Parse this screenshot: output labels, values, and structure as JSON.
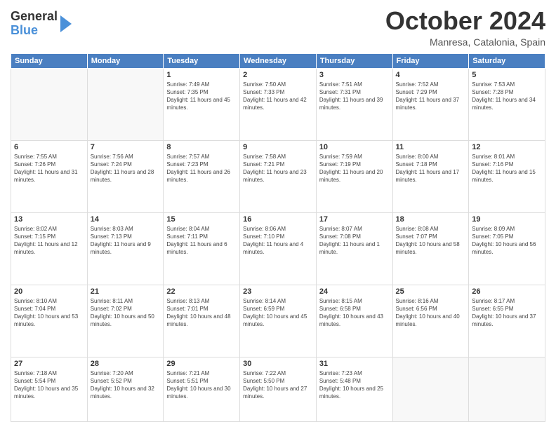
{
  "logo": {
    "general": "General",
    "blue": "Blue"
  },
  "header": {
    "title": "October 2024",
    "location": "Manresa, Catalonia, Spain"
  },
  "weekdays": [
    "Sunday",
    "Monday",
    "Tuesday",
    "Wednesday",
    "Thursday",
    "Friday",
    "Saturday"
  ],
  "days": [
    {
      "date": "",
      "sunrise": "",
      "sunset": "",
      "daylight": ""
    },
    {
      "date": "",
      "sunrise": "",
      "sunset": "",
      "daylight": ""
    },
    {
      "date": "1",
      "sunrise": "Sunrise: 7:49 AM",
      "sunset": "Sunset: 7:35 PM",
      "daylight": "Daylight: 11 hours and 45 minutes."
    },
    {
      "date": "2",
      "sunrise": "Sunrise: 7:50 AM",
      "sunset": "Sunset: 7:33 PM",
      "daylight": "Daylight: 11 hours and 42 minutes."
    },
    {
      "date": "3",
      "sunrise": "Sunrise: 7:51 AM",
      "sunset": "Sunset: 7:31 PM",
      "daylight": "Daylight: 11 hours and 39 minutes."
    },
    {
      "date": "4",
      "sunrise": "Sunrise: 7:52 AM",
      "sunset": "Sunset: 7:29 PM",
      "daylight": "Daylight: 11 hours and 37 minutes."
    },
    {
      "date": "5",
      "sunrise": "Sunrise: 7:53 AM",
      "sunset": "Sunset: 7:28 PM",
      "daylight": "Daylight: 11 hours and 34 minutes."
    },
    {
      "date": "6",
      "sunrise": "Sunrise: 7:55 AM",
      "sunset": "Sunset: 7:26 PM",
      "daylight": "Daylight: 11 hours and 31 minutes."
    },
    {
      "date": "7",
      "sunrise": "Sunrise: 7:56 AM",
      "sunset": "Sunset: 7:24 PM",
      "daylight": "Daylight: 11 hours and 28 minutes."
    },
    {
      "date": "8",
      "sunrise": "Sunrise: 7:57 AM",
      "sunset": "Sunset: 7:23 PM",
      "daylight": "Daylight: 11 hours and 26 minutes."
    },
    {
      "date": "9",
      "sunrise": "Sunrise: 7:58 AM",
      "sunset": "Sunset: 7:21 PM",
      "daylight": "Daylight: 11 hours and 23 minutes."
    },
    {
      "date": "10",
      "sunrise": "Sunrise: 7:59 AM",
      "sunset": "Sunset: 7:19 PM",
      "daylight": "Daylight: 11 hours and 20 minutes."
    },
    {
      "date": "11",
      "sunrise": "Sunrise: 8:00 AM",
      "sunset": "Sunset: 7:18 PM",
      "daylight": "Daylight: 11 hours and 17 minutes."
    },
    {
      "date": "12",
      "sunrise": "Sunrise: 8:01 AM",
      "sunset": "Sunset: 7:16 PM",
      "daylight": "Daylight: 11 hours and 15 minutes."
    },
    {
      "date": "13",
      "sunrise": "Sunrise: 8:02 AM",
      "sunset": "Sunset: 7:15 PM",
      "daylight": "Daylight: 11 hours and 12 minutes."
    },
    {
      "date": "14",
      "sunrise": "Sunrise: 8:03 AM",
      "sunset": "Sunset: 7:13 PM",
      "daylight": "Daylight: 11 hours and 9 minutes."
    },
    {
      "date": "15",
      "sunrise": "Sunrise: 8:04 AM",
      "sunset": "Sunset: 7:11 PM",
      "daylight": "Daylight: 11 hours and 6 minutes."
    },
    {
      "date": "16",
      "sunrise": "Sunrise: 8:06 AM",
      "sunset": "Sunset: 7:10 PM",
      "daylight": "Daylight: 11 hours and 4 minutes."
    },
    {
      "date": "17",
      "sunrise": "Sunrise: 8:07 AM",
      "sunset": "Sunset: 7:08 PM",
      "daylight": "Daylight: 11 hours and 1 minute."
    },
    {
      "date": "18",
      "sunrise": "Sunrise: 8:08 AM",
      "sunset": "Sunset: 7:07 PM",
      "daylight": "Daylight: 10 hours and 58 minutes."
    },
    {
      "date": "19",
      "sunrise": "Sunrise: 8:09 AM",
      "sunset": "Sunset: 7:05 PM",
      "daylight": "Daylight: 10 hours and 56 minutes."
    },
    {
      "date": "20",
      "sunrise": "Sunrise: 8:10 AM",
      "sunset": "Sunset: 7:04 PM",
      "daylight": "Daylight: 10 hours and 53 minutes."
    },
    {
      "date": "21",
      "sunrise": "Sunrise: 8:11 AM",
      "sunset": "Sunset: 7:02 PM",
      "daylight": "Daylight: 10 hours and 50 minutes."
    },
    {
      "date": "22",
      "sunrise": "Sunrise: 8:13 AM",
      "sunset": "Sunset: 7:01 PM",
      "daylight": "Daylight: 10 hours and 48 minutes."
    },
    {
      "date": "23",
      "sunrise": "Sunrise: 8:14 AM",
      "sunset": "Sunset: 6:59 PM",
      "daylight": "Daylight: 10 hours and 45 minutes."
    },
    {
      "date": "24",
      "sunrise": "Sunrise: 8:15 AM",
      "sunset": "Sunset: 6:58 PM",
      "daylight": "Daylight: 10 hours and 43 minutes."
    },
    {
      "date": "25",
      "sunrise": "Sunrise: 8:16 AM",
      "sunset": "Sunset: 6:56 PM",
      "daylight": "Daylight: 10 hours and 40 minutes."
    },
    {
      "date": "26",
      "sunrise": "Sunrise: 8:17 AM",
      "sunset": "Sunset: 6:55 PM",
      "daylight": "Daylight: 10 hours and 37 minutes."
    },
    {
      "date": "27",
      "sunrise": "Sunrise: 7:18 AM",
      "sunset": "Sunset: 5:54 PM",
      "daylight": "Daylight: 10 hours and 35 minutes."
    },
    {
      "date": "28",
      "sunrise": "Sunrise: 7:20 AM",
      "sunset": "Sunset: 5:52 PM",
      "daylight": "Daylight: 10 hours and 32 minutes."
    },
    {
      "date": "29",
      "sunrise": "Sunrise: 7:21 AM",
      "sunset": "Sunset: 5:51 PM",
      "daylight": "Daylight: 10 hours and 30 minutes."
    },
    {
      "date": "30",
      "sunrise": "Sunrise: 7:22 AM",
      "sunset": "Sunset: 5:50 PM",
      "daylight": "Daylight: 10 hours and 27 minutes."
    },
    {
      "date": "31",
      "sunrise": "Sunrise: 7:23 AM",
      "sunset": "Sunset: 5:48 PM",
      "daylight": "Daylight: 10 hours and 25 minutes."
    },
    {
      "date": "",
      "sunrise": "",
      "sunset": "",
      "daylight": ""
    },
    {
      "date": "",
      "sunrise": "",
      "sunset": "",
      "daylight": ""
    }
  ]
}
